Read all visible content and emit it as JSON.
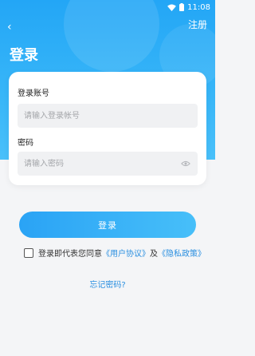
{
  "status_bar": {
    "time": "11:08"
  },
  "header": {
    "register_label": "注册",
    "title": "登录"
  },
  "form": {
    "account_label": "登录账号",
    "account_placeholder": "请输入登录帐号",
    "password_label": "密码",
    "password_placeholder": "请输入密码"
  },
  "login_button": "登录",
  "agreement": {
    "prefix": "登录即代表您同意",
    "user_agreement": "《用户协议》",
    "and": "及",
    "privacy_policy": "《隐私政策》"
  },
  "forgot_password": "忘记密码?",
  "colors": {
    "accent": "#2aa3f5",
    "link": "#2a8fe0",
    "background": "#f4f5f7"
  }
}
